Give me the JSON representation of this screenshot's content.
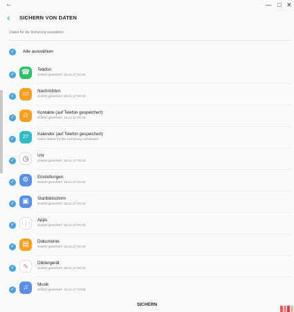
{
  "window": {
    "back_icon": "arrow-left-icon",
    "minimize_icon": "minimize-icon",
    "maximize_icon": "maximize-icon",
    "close_icon": "close-icon"
  },
  "header": {
    "back_icon": "chevron-left-icon",
    "title": "SICHERN VON DATEN"
  },
  "subtitle": "Daten für die Sicherung auswählen",
  "select_all": {
    "label": "Alle auswählen",
    "checked": true
  },
  "items": [
    {
      "name": "Telefon",
      "status": "Zuletzt gesichert: 18.11.17 04:32",
      "icon": "phone-icon",
      "color": "#2fc26a",
      "checked": true
    },
    {
      "name": "Nachrichten",
      "status": "Zuletzt gesichert: 18.11.17 04:32",
      "icon": "message-icon",
      "color": "#f4a024",
      "checked": true
    },
    {
      "name": "Kontakte (auf Telefon gespeichert)",
      "status": "Zuletzt gesichert: 18.11.17 04:32",
      "icon": "contacts-icon",
      "color": "#f4a024",
      "checked": true
    },
    {
      "name": "Kalender (auf Telefon gespeichert)",
      "status": "Keine Daten für die Sicherung vorhanden",
      "icon": "calendar-icon",
      "color": "#33b8c4",
      "checked": true
    },
    {
      "name": "Uhr",
      "status": "Zuletzt gesichert: 18.11.17 04:32",
      "icon": "clock-icon",
      "color": "#ffffff",
      "checked": true
    },
    {
      "name": "Einstellungen",
      "status": "Zuletzt gesichert: 18.11.17 04:31",
      "icon": "gear-icon",
      "color": "#5b8ee6",
      "checked": true
    },
    {
      "name": "Startbildschirm",
      "status": "Zuletzt gesichert: 18.11.17 04:32",
      "icon": "home-screen-icon",
      "color": "#5b8ee6",
      "checked": true
    },
    {
      "name": "Apps",
      "status": "Zuletzt gesichert: 18.11.17 04:32",
      "icon": "apps-grid-icon",
      "color": "#ffffff",
      "checked": true
    },
    {
      "name": "Dokumente",
      "status": "Zuletzt gesichert: 18.11.17 04:32",
      "icon": "folder-icon",
      "color": "#f4a024",
      "checked": true
    },
    {
      "name": "Diktiergerät",
      "status": "Zuletzt gesichert: 18.11.17 04:32",
      "icon": "voice-recorder-icon",
      "color": "#ffffff",
      "checked": true
    },
    {
      "name": "Musik",
      "status": "Zuletzt gesichert: 10.11.17 10:55",
      "icon": "music-icon",
      "color": "#5b8ee6",
      "checked": true
    }
  ],
  "footer": {
    "button_label": "SICHERN"
  },
  "colors": {
    "accent": "#4fa3dc",
    "background": "#fafafa"
  }
}
